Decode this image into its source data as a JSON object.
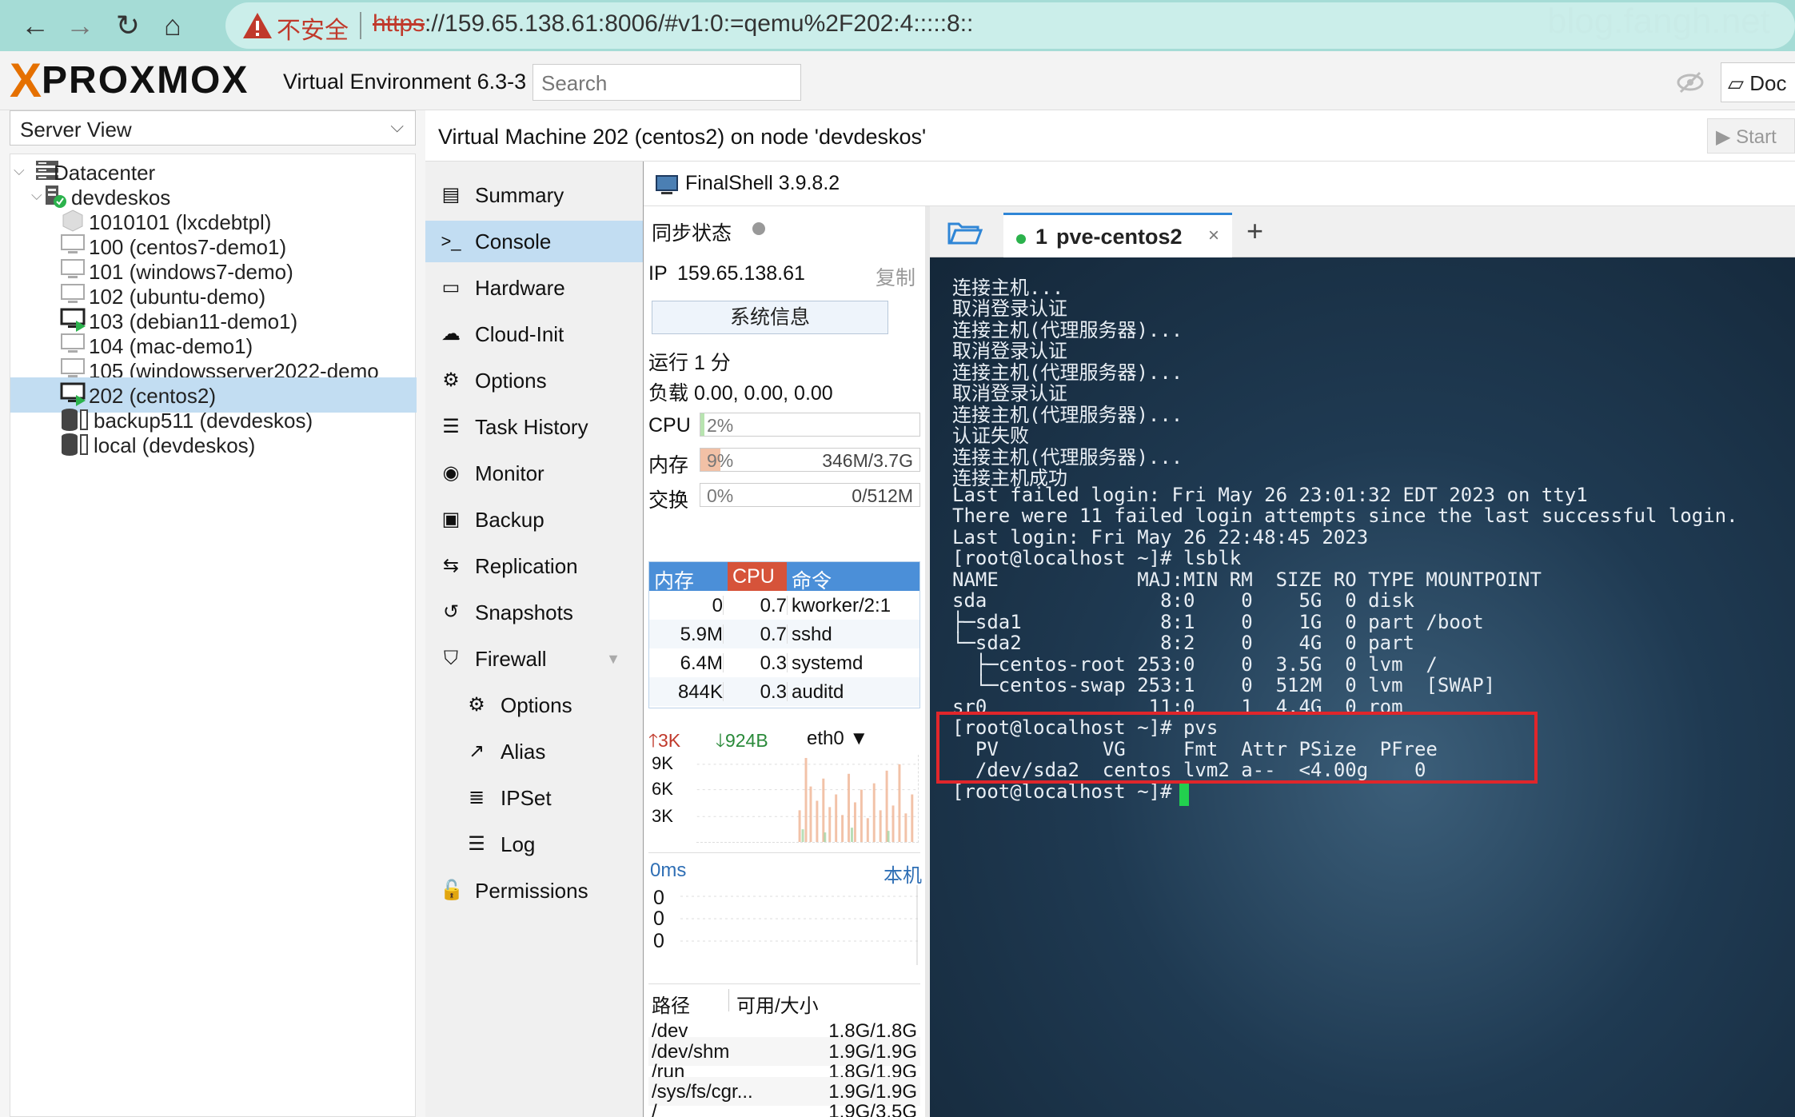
{
  "browser": {
    "back_glyph": "←",
    "forward_glyph": "→",
    "reload_glyph": "↻",
    "home_glyph": "⌂",
    "insecure_label": "不安全",
    "url_scheme": "https",
    "url_rest": "://159.65.138.61:8006/#v1:0:=qemu%2F202:4:::::8::",
    "watermark": "blog.fangh.net"
  },
  "header": {
    "logo_text": "PROXMOX",
    "version": "Virtual Environment 6.3-3",
    "search_placeholder": "Search",
    "doc_label": "Doc"
  },
  "tree": {
    "view_label": "Server View",
    "items": [
      {
        "label": "Datacenter",
        "icon": "datacenter-icon"
      },
      {
        "label": "devdeskos",
        "icon": "node-icon"
      },
      {
        "label": "1010101 (lxcdebtpl)",
        "icon": "container-template-icon"
      },
      {
        "label": "100 (centos7-demo1)",
        "icon": "vm-icon"
      },
      {
        "label": "101 (windows7-demo)",
        "icon": "vm-icon"
      },
      {
        "label": "102 (ubuntu-demo)",
        "icon": "vm-icon"
      },
      {
        "label": "103 (debian11-demo1)",
        "icon": "vm-running-icon"
      },
      {
        "label": "104 (mac-demo1)",
        "icon": "vm-icon"
      },
      {
        "label": "105 (windowsserver2022-demo",
        "icon": "vm-icon"
      },
      {
        "label": "202 (centos2)",
        "icon": "vm-running-icon"
      },
      {
        "label": "backup511 (devdeskos)",
        "icon": "storage-icon"
      },
      {
        "label": "local (devdeskos)",
        "icon": "storage-icon"
      }
    ]
  },
  "vm": {
    "title": "Virtual Machine 202 (centos2) on node 'devdeskos'",
    "start_label": "Start"
  },
  "menu": {
    "items": [
      {
        "label": "Summary",
        "icon": "▤"
      },
      {
        "label": "Console",
        "icon": ">_"
      },
      {
        "label": "Hardware",
        "icon": "▭"
      },
      {
        "label": "Cloud-Init",
        "icon": "☁"
      },
      {
        "label": "Options",
        "icon": "⚙"
      },
      {
        "label": "Task History",
        "icon": "☰"
      },
      {
        "label": "Monitor",
        "icon": "◉"
      },
      {
        "label": "Backup",
        "icon": "▣"
      },
      {
        "label": "Replication",
        "icon": "⇆"
      },
      {
        "label": "Snapshots",
        "icon": "↺"
      },
      {
        "label": "Firewall",
        "icon": "⛉"
      },
      {
        "label": "Options",
        "icon": "⚙"
      },
      {
        "label": "Alias",
        "icon": "↗"
      },
      {
        "label": "IPSet",
        "icon": "≣"
      },
      {
        "label": "Log",
        "icon": "☰"
      },
      {
        "label": "Permissions",
        "icon": "🔓"
      }
    ]
  },
  "finalshell": {
    "title": "FinalShell 3.9.8.2",
    "sync_label": "同步状态",
    "ip_label": "IP",
    "ip_value": "159.65.138.61",
    "copy_label": "复制",
    "sysinfo_label": "系统信息",
    "uptime": "运行 1 分",
    "load": "负载 0.00, 0.00, 0.00",
    "cpu": {
      "label": "CPU",
      "percent": 2,
      "text": "2%",
      "value": ""
    },
    "mem": {
      "label": "内存",
      "percent": 9,
      "text": "9%",
      "value": "346M/3.7G"
    },
    "swap": {
      "label": "交换",
      "percent": 0,
      "text": "0%",
      "value": "0/512M"
    },
    "proc_headers": [
      "内存",
      "CPU",
      "命令"
    ],
    "processes": [
      {
        "mem": "0",
        "cpu": "0.7",
        "cmd": "kworker/2:1"
      },
      {
        "mem": "5.9M",
        "cpu": "0.7",
        "cmd": "sshd"
      },
      {
        "mem": "6.4M",
        "cpu": "0.3",
        "cmd": "systemd"
      },
      {
        "mem": "844K",
        "cpu": "0.3",
        "cmd": "auditd"
      }
    ],
    "net": {
      "up": "3K",
      "down": "924B",
      "iface": "eth0",
      "y_ticks": [
        "9K",
        "6K",
        "3K"
      ]
    },
    "ping": {
      "latency": "0ms",
      "target": "本机",
      "values": [
        "0",
        "0",
        "0"
      ]
    },
    "disk_headers": [
      "路径",
      "可用/大小"
    ],
    "disks": [
      {
        "path": "/dev",
        "value": "1.8G/1.8G"
      },
      {
        "path": "/dev/shm",
        "value": "1.9G/1.9G"
      },
      {
        "path": "/run",
        "value": "1.8G/1.9G"
      },
      {
        "path": "/sys/fs/cgr...",
        "value": "1.9G/1.9G"
      },
      {
        "path": "/",
        "value": "1.9G/3.5G"
      }
    ],
    "tab": {
      "num": "1",
      "name": "pve-centos2",
      "close": "×"
    },
    "plus": "+"
  },
  "terminal": {
    "lines": [
      "连接主机...",
      "取消登录认证",
      "连接主机(代理服务器)...",
      "取消登录认证",
      "连接主机(代理服务器)...",
      "取消登录认证",
      "连接主机(代理服务器)...",
      "认证失败",
      "连接主机(代理服务器)...",
      "连接主机成功",
      "Last failed login: Fri May 26 23:01:32 EDT 2023 on tty1",
      "There were 11 failed login attempts since the last successful login.",
      "Last login: Fri May 26 22:48:45 2023",
      "[root@localhost ~]# lsblk",
      "NAME            MAJ:MIN RM  SIZE RO TYPE MOUNTPOINT",
      "sda               8:0    0    5G  0 disk",
      "├─sda1            8:1    0    1G  0 part /boot",
      "└─sda2            8:2    0    4G  0 part",
      "  ├─centos-root 253:0    0  3.5G  0 lvm  /",
      "  └─centos-swap 253:1    0  512M  0 lvm  [SWAP]",
      "sr0              11:0    1  4.4G  0 rom",
      "[root@localhost ~]# pvs",
      "  PV         VG     Fmt  Attr PSize  PFree",
      "  /dev/sda2  centos lvm2 a--  <4.00g    0",
      "[root@localhost ~]#"
    ]
  }
}
